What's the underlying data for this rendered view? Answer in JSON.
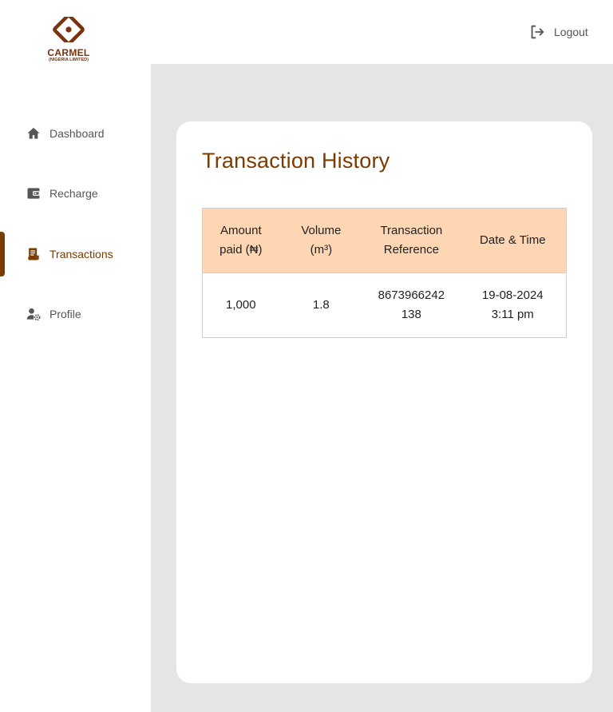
{
  "brand": {
    "name": "CARMEL",
    "subtitle": "(NIGERIA LIMITED)",
    "color": "#7a3310"
  },
  "header": {
    "logout_label": "Logout",
    "logout_icon": "logout-icon"
  },
  "sidebar": {
    "items": [
      {
        "label": "Dashboard",
        "icon": "home-icon",
        "active": false
      },
      {
        "label": "Recharge",
        "icon": "wallet-icon",
        "active": false
      },
      {
        "label": "Transactions",
        "icon": "receipt-icon",
        "active": true
      },
      {
        "label": "Profile",
        "icon": "user-settings-icon",
        "active": false
      }
    ],
    "active_color": "#7a3c00"
  },
  "main": {
    "title": "Transaction History",
    "table": {
      "headers": [
        "Amount\npaid (₦)",
        "Volume\n(m³)",
        "Transaction\nReference",
        "Date & Time"
      ],
      "header_bg": "#ffd6b3",
      "rows": [
        [
          "1,000",
          "1.8",
          "8673966242\n138",
          "19-08-2024\n3:11 pm"
        ]
      ]
    }
  }
}
